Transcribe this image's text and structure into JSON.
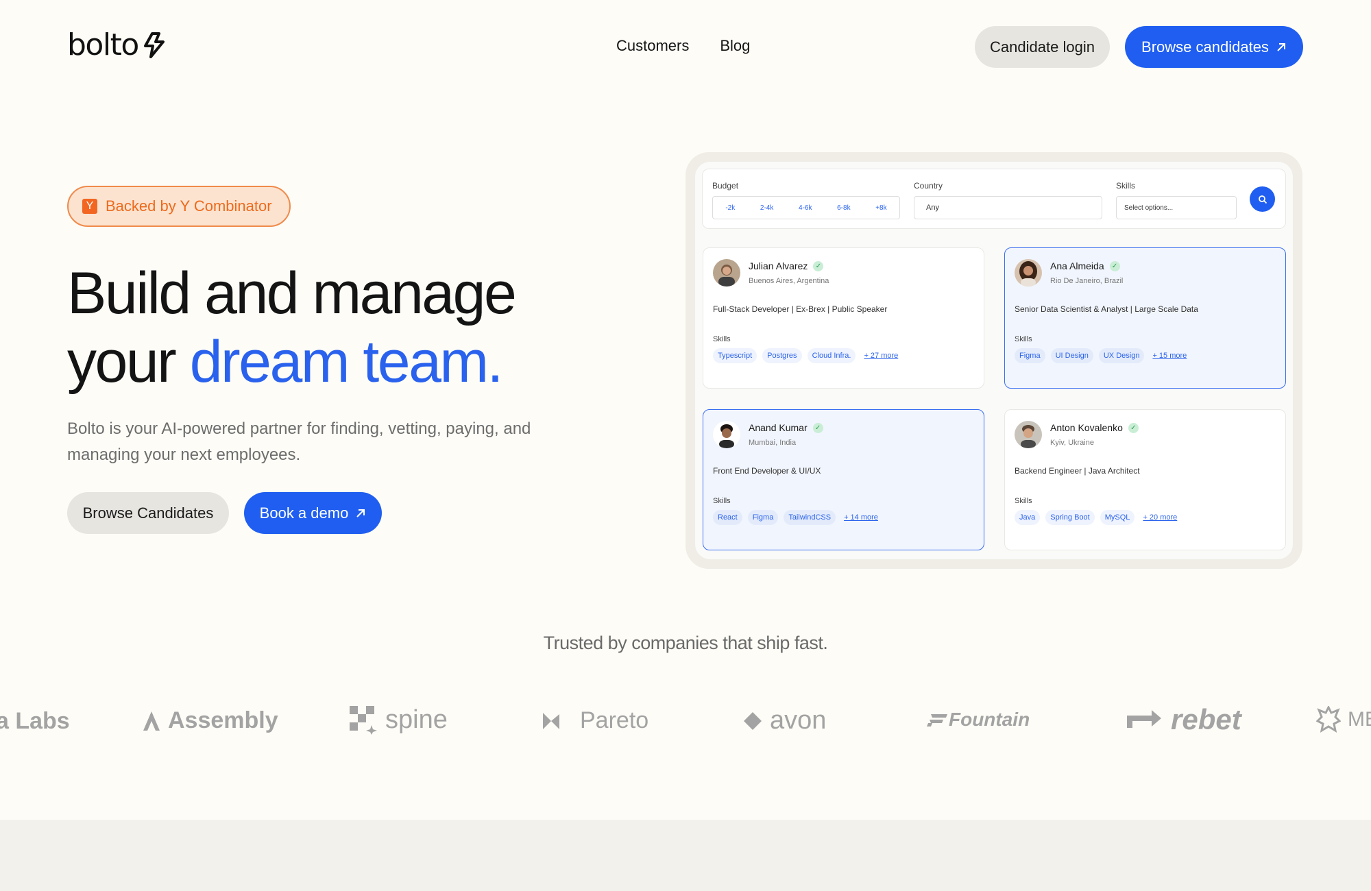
{
  "nav": {
    "logo": "bolto",
    "links": [
      "Customers",
      "Blog"
    ],
    "login_label": "Candidate login",
    "browse_label": "Browse candidates"
  },
  "hero": {
    "badge_text": "Backed by Y Combinator",
    "badge_icon": "Y",
    "headline_line1": "Build and manage",
    "headline_line2_plain": "your ",
    "headline_line2_accent": "dream team.",
    "subtext": "Bolto is your AI-powered partner for finding, vetting, paying, and managing your next employees.",
    "cta_browse": "Browse Candidates",
    "cta_demo": "Book a demo"
  },
  "filters": {
    "budget_label": "Budget",
    "budget_options": [
      "-2k",
      "2-4k",
      "4-6k",
      "6-8k",
      "+8k"
    ],
    "country_label": "Country",
    "country_value": "Any",
    "skills_label": "Skills",
    "skills_placeholder": "Select options..."
  },
  "skills_heading": "Skills",
  "candidates": [
    {
      "name": "Julian Alvarez",
      "location": "Buenos Aires, Argentina",
      "title": "Full-Stack Developer | Ex-Brex | Public Speaker",
      "skills": [
        "Typescript",
        "Postgres",
        "Cloud Infra."
      ],
      "more": "+ 27 more",
      "selected": false
    },
    {
      "name": "Ana Almeida",
      "location": "Rio De Janeiro, Brazil",
      "title": "Senior Data Scientist & Analyst | Large Scale Data",
      "skills": [
        "Figma",
        "UI Design",
        "UX Design"
      ],
      "more": "+ 15 more",
      "selected": true
    },
    {
      "name": "Anand Kumar",
      "location": "Mumbai, India",
      "title": "Front End Developer & UI/UX",
      "skills": [
        "React",
        "Figma",
        "TailwindCSS"
      ],
      "more": "+ 14 more",
      "selected": true
    },
    {
      "name": "Anton Kovalenko",
      "location": "Kyiv, Ukraine",
      "title": "Backend Engineer | Java Architect",
      "skills": [
        "Java",
        "Spring Boot",
        "MySQL"
      ],
      "more": "+ 20 more",
      "selected": false
    }
  ],
  "trusted": {
    "heading": "Trusted by companies that ship fast.",
    "logos": [
      "a Labs",
      "Assembly",
      "spine",
      "Pareto",
      "avon",
      "Fountain",
      "rebet",
      "ME"
    ]
  },
  "colors": {
    "accent": "#1f5ef0",
    "badge_orange": "#ee6a1b",
    "background": "#fdfcf6"
  }
}
